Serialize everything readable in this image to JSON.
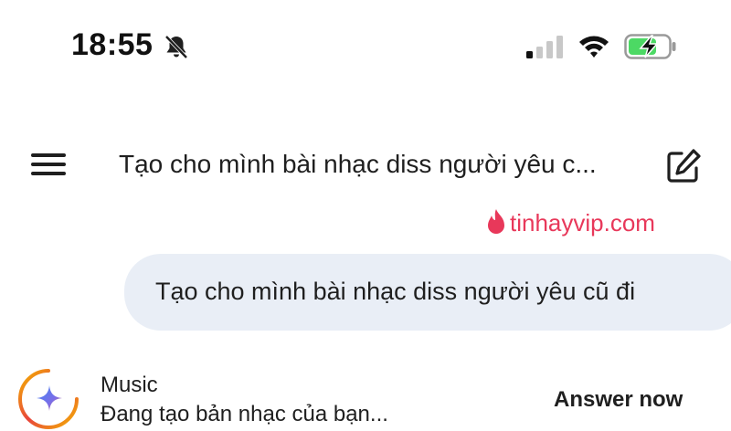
{
  "status_bar": {
    "time": "18:55",
    "icons": [
      "bell-slash-icon",
      "signal-icon",
      "wifi-icon",
      "battery-charging-icon"
    ],
    "battery_color": "#4cd964"
  },
  "header": {
    "menu_icon": "hamburger-menu-icon",
    "title": "Tạo cho mình bài nhạc diss người yêu c...",
    "new_chat_icon": "edit-square-icon"
  },
  "watermark": {
    "text": "tinhayvip.com",
    "color": "#e8385a"
  },
  "conversation": {
    "user_message": "Tạo cho mình bài nhạc diss người yêu cũ đi",
    "bubble_color": "#e9eef6"
  },
  "response": {
    "tool_name": "Music",
    "status": "Đang tạo bản nhạc của bạn...",
    "action_label": "Answer now",
    "avatar_icon": "gemini-sparkle-icon"
  }
}
